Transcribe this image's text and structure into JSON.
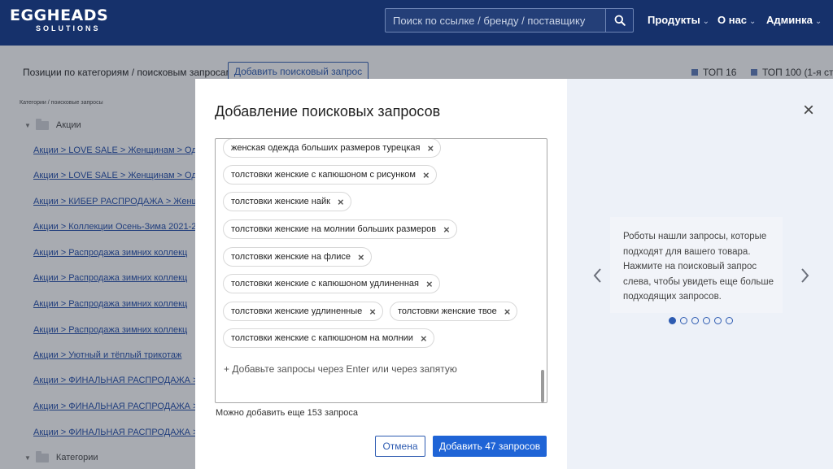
{
  "header": {
    "logo_main": "EGGHEADS",
    "logo_sub": "SOLUTIONS",
    "search_placeholder": "Поиск по ссылке / бренду / поставщику",
    "nav": [
      {
        "label": "Продукты"
      },
      {
        "label": "О нас"
      },
      {
        "label": "Админка"
      }
    ]
  },
  "page": {
    "toolbar_label": "Позиции по категориям / поисковым запросам",
    "add_query_button": "Добавить поисковый запрос",
    "legend": [
      {
        "label": "ТОП 16"
      },
      {
        "label": "ТОП 100 (1-я ст"
      }
    ],
    "column_header": "Категории / поисковые запросы",
    "folders": [
      {
        "label": "Акции"
      },
      {
        "label": "Категории"
      }
    ],
    "tree_links": [
      "Акции > LOVE SALE > Женщинам > Оде",
      "Акции > LOVE SALE > Женщинам > Оде",
      "Акции > КИБЕР РАСПРОДАЖА > Женщ",
      "Акции > Коллекции Осень-Зима 2021-2",
      "Акции > Распродажа зимних коллекц",
      "Акции > Распродажа зимних коллекц",
      "Акции > Распродажа зимних коллекц",
      "Акции > Распродажа зимних коллекц",
      "Акции > Уютный и тёплый трикотаж",
      "Акции > ФИНАЛЬНАЯ РАСПРОДАЖА > Ж",
      "Акции > ФИНАЛЬНАЯ РАСПРОДАЖА > Ж",
      "Акции > ФИНАЛЬНАЯ РАСПРОДАЖА > Ж"
    ]
  },
  "modal": {
    "title": "Добавление поисковых запросов",
    "tags": [
      "женская одежда больших размеров турецкая",
      "толстовки женские с капюшоном с рисунком",
      "толстовки женские найк",
      "толстовки женские на молнии больших размеров",
      "толстовки женские на флисе",
      "толстовки женские с капюшоном удлиненная",
      "толстовки женские удлиненные",
      "толстовки женские твое",
      "толстовки женские с капюшоном на молнии"
    ],
    "add_hint": "+ Добавьте запросы через Enter или через запятую",
    "remaining": "Можно добавить еще 153 запроса",
    "cancel": "Отмена",
    "submit": "Добавить 47 запросов",
    "close_symbol": "×",
    "tip": "Роботы нашли запросы, которые подходят для вашего товара. Нажмите на поисковый запрос слева, чтобы увидеть еще больше подходящих запросов.",
    "dots_total": 6,
    "dots_active_index": 0
  },
  "colors": {
    "header_bg": "#16316b",
    "accent": "#1f64d6",
    "link": "#1e4aa8",
    "tip_panel": "#edf1f8"
  },
  "icons": [
    "search-icon",
    "chevron-down-icon",
    "folder-icon",
    "remove-tag-icon",
    "close-icon",
    "chevron-left-icon",
    "chevron-right-icon"
  ]
}
